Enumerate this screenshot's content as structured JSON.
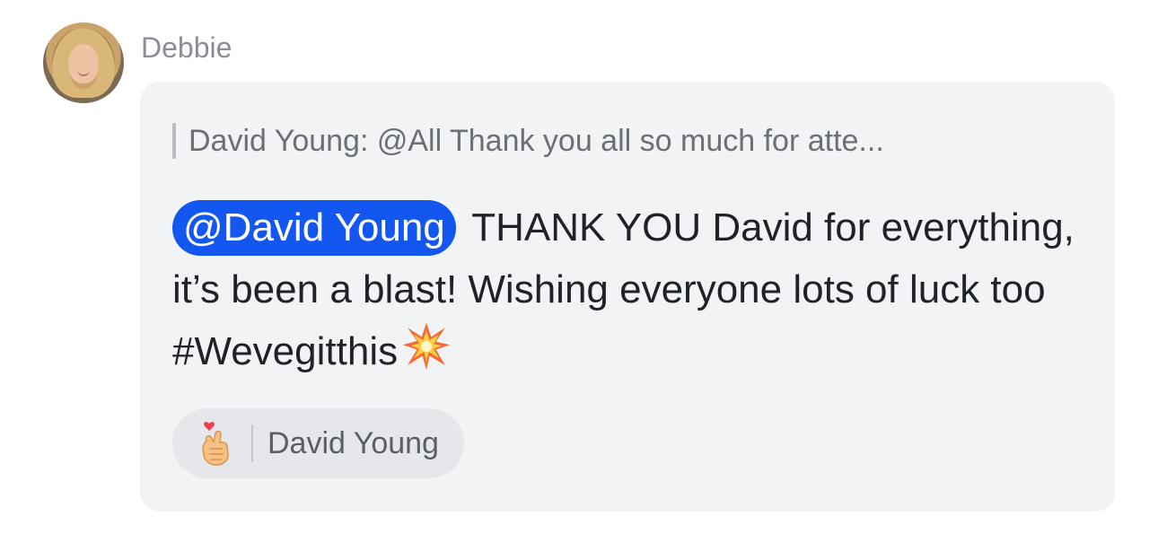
{
  "message": {
    "sender_name": "Debbie",
    "quote_text": "David Young: @All Thank you all so much for atte...",
    "mention": "@David Young",
    "text_line1": "THANK YOU David for",
    "text_rest": "everything, it’s been a blast! Wishing everyone lots of luck too #Wevegitthis",
    "trailing_emoji": "collision-emoji",
    "reaction": {
      "emoji": "finger-heart-emoji",
      "user": "David Young"
    }
  },
  "colors": {
    "bubble": "#f2f3f5",
    "mention_bg": "#1456f0",
    "reaction_bg": "#e6e7ea"
  }
}
